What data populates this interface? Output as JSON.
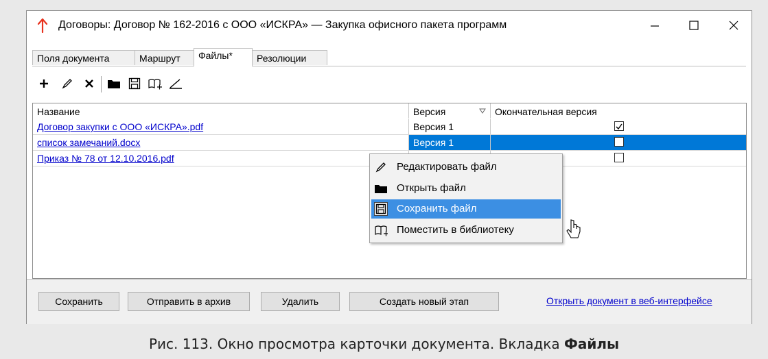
{
  "window": {
    "title": "Договоры: Договор № 162-2016 с ООО «ИСКРА» — Закупка офисного пакета программ"
  },
  "tabs": [
    {
      "label": "Поля документа"
    },
    {
      "label": "Маршрут"
    },
    {
      "label": "Файлы*"
    },
    {
      "label": "Резолюции"
    }
  ],
  "toolbar": {
    "icons": [
      "add-icon",
      "edit-icon",
      "delete-icon",
      "open-folder-icon",
      "save-icon",
      "library-icon",
      "sign-icon"
    ]
  },
  "grid": {
    "columns": [
      "Название",
      "Версия",
      "Окончательная версия"
    ],
    "rows": [
      {
        "name": "Договор закупки с ООО «ИСКРА».pdf",
        "version": "Версия 1",
        "final": true
      },
      {
        "name": "список замечаний.docx",
        "version": "Версия 1",
        "final": false
      },
      {
        "name": "Приказ № 78 от 12.10.2016.pdf",
        "version": "",
        "final": false
      }
    ]
  },
  "context_menu": {
    "items": [
      {
        "label": "Редактировать файл",
        "icon": "edit-icon"
      },
      {
        "label": "Открыть файл",
        "icon": "folder-icon"
      },
      {
        "label": "Сохранить файл",
        "icon": "save-icon"
      },
      {
        "label": "Поместить в библиотеку",
        "icon": "library-icon"
      }
    ],
    "highlighted_index": 2
  },
  "buttons": {
    "save": "Сохранить",
    "archive": "Отправить в архив",
    "delete": "Удалить",
    "new_stage": "Создать новый этап",
    "web_link": "Открыть документ в веб-интерфейсе"
  },
  "caption": {
    "prefix": "Рис. 113. Окно просмотра карточки документа. Вкладка ",
    "bold": "Файлы"
  },
  "colors": {
    "selection": "#0078d7",
    "menu_highlight": "#3c8fe3",
    "link": "#0000cc",
    "app_icon": "#e8321e"
  }
}
